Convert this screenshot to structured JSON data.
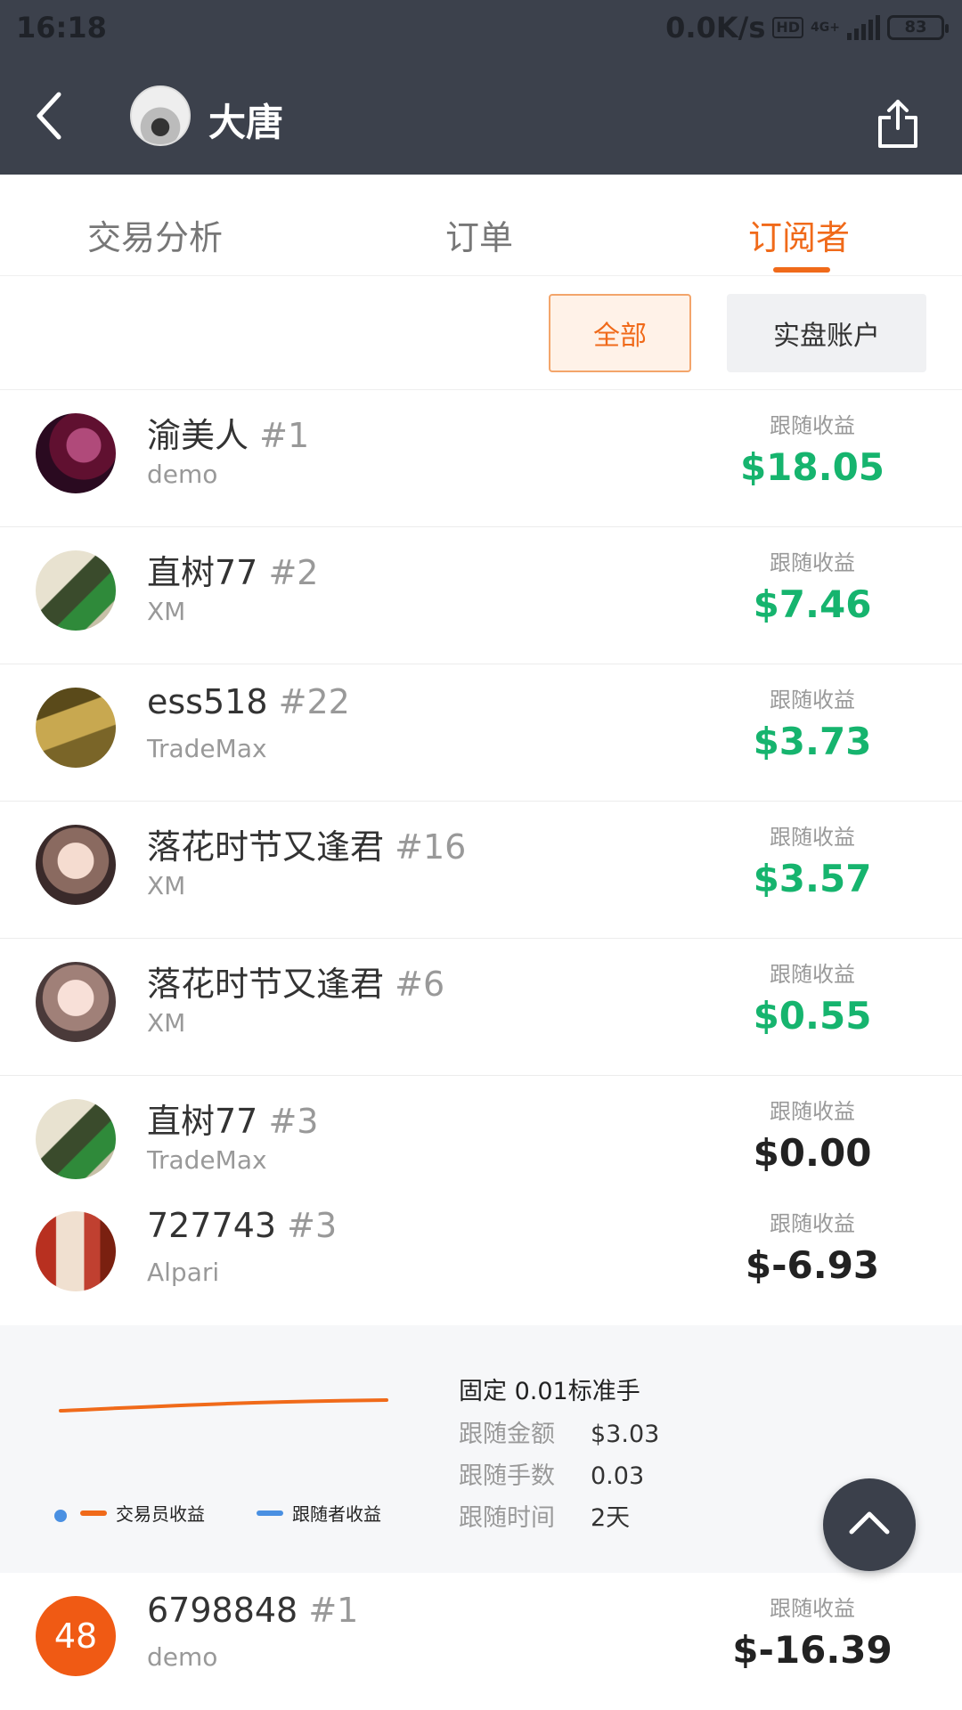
{
  "status_bar": {
    "time": "16:18",
    "network_speed": "0.0K/s",
    "hd": "HD",
    "signal": "4G+",
    "battery": "83"
  },
  "header": {
    "title": "大唐",
    "back_icon": "chevron-left-icon",
    "share_icon": "share-icon"
  },
  "tabs": [
    {
      "label": "交易分析",
      "active": false
    },
    {
      "label": "订单",
      "active": false
    },
    {
      "label": "订阅者",
      "active": true
    }
  ],
  "filters": {
    "all": "全部",
    "real": "实盘账户",
    "selected": "全部"
  },
  "subscribers": [
    {
      "name": "渝美人",
      "rank": "#1",
      "broker": "demo",
      "label": "跟随收益",
      "profit": "$18.05"
    },
    {
      "name": "直树77",
      "rank": "#2",
      "broker": "XM",
      "label": "跟随收益",
      "profit": "$7.46"
    },
    {
      "name": "ess518",
      "rank": "#22",
      "broker": "TradeMax",
      "label": "跟随收益",
      "profit": "$3.73"
    },
    {
      "name": "落花时节又逢君",
      "rank": "#16",
      "broker": "XM",
      "label": "跟随收益",
      "profit": "$3.57"
    },
    {
      "name": "落花时节又逢君",
      "rank": "#6",
      "broker": "XM",
      "label": "跟随收益",
      "profit": "$0.55"
    },
    {
      "name": "直树77",
      "rank": "#3",
      "broker": "TradeMax",
      "label": "跟随收益",
      "profit": "$0.00"
    },
    {
      "name": "727743",
      "rank": "#3",
      "broker": "Alpari",
      "label": "跟随收益",
      "profit": "$-6.93"
    },
    {
      "name": "6798848",
      "rank": "#1",
      "broker": "demo",
      "label": "跟随收益",
      "profit": "$-16.39",
      "avatar_text": "48"
    }
  ],
  "expanded": {
    "legend_trader": "交易员收益",
    "legend_follower": "跟随者收益",
    "mode": "固定 0.01标准手",
    "amount_label": "跟随金额",
    "amount_value": "$3.03",
    "lots_label": "跟随手数",
    "lots_value": "0.03",
    "time_label": "跟随时间",
    "time_value": "2天"
  },
  "colors": {
    "accent": "#f06a1a",
    "positive": "#16b46e",
    "header_bg": "#3c414c",
    "follower_line": "#4a90e2"
  }
}
